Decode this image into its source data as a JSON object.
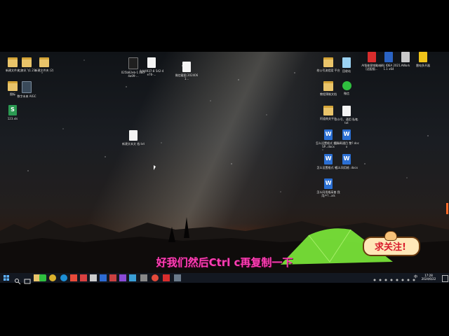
{
  "desktop": {
    "icons_left": [
      {
        "label": "新建文件夹",
        "type": "folder"
      },
      {
        "label": "红旗讯飞1.21",
        "type": "folder"
      },
      {
        "label": "新建文件夹 (2)",
        "type": "folder"
      },
      {
        "label": "图标",
        "type": "folder"
      },
      {
        "label": "数字未来 AIGC",
        "type": "shortcut"
      },
      {
        "label": "123.xls",
        "type": "xls"
      },
      {
        "label": "025b82eb-1 a8d-4a09-...",
        "type": "dark"
      },
      {
        "label": "4dd4937-8 542-4e76-...",
        "type": "doc"
      },
      {
        "label": "微信截图 2024061...",
        "type": "doc"
      },
      {
        "label": "新建文本文 档.txt",
        "type": "doc"
      }
    ],
    "icons_right": [
      {
        "label": "校公号流程案 平台",
        "type": "folder"
      },
      {
        "label": "回收站",
        "type": "recycle"
      },
      {
        "label": "教程预制文档",
        "type": "folder"
      },
      {
        "label": "微信",
        "type": "wechat"
      },
      {
        "label": "阿道南关平台",
        "type": "folder"
      },
      {
        "label": "公众号、通用 私笔.txt",
        "type": "doc"
      },
      {
        "label": "怎么设置格式 按照ASP...docx",
        "type": "word"
      },
      {
        "label": "怎么同通目 整?.docx",
        "type": "word"
      },
      {
        "label": "怎么设置格式 单...",
        "type": "word"
      },
      {
        "label": "怎么同用格 .docx",
        "type": "word"
      },
      {
        "label": "怎么同用格高普 我用户?...xls",
        "type": "word"
      }
    ],
    "icons_top_right": [
      {
        "label": "AI智能营销助 业 [适配版...",
        "type": "red"
      },
      {
        "label": "IntelliJ IDEA 2021.1.1 x64",
        "type": "blue"
      },
      {
        "label": "AWork",
        "type": "gray"
      },
      {
        "label": "雷电多开器",
        "type": "yellow"
      }
    ]
  },
  "caption": "好我们然后Ctrl c再复制一下",
  "sticker": "求关注!",
  "taskbar": {
    "start_icon": "windows-start-icon",
    "apps": [
      "search-icon",
      "task-view-icon",
      "explorer-icon",
      "chrome-icon",
      "edge-icon",
      "app-icon",
      "wps-icon",
      "app-icon",
      "app-icon",
      "app-icon",
      "app-icon",
      "app-icon",
      "app-icon",
      "app-icon",
      "app-icon",
      "chrome-icon",
      "wps-icon",
      "app-icon"
    ],
    "clock_time": "17:28",
    "clock_date": "2024/6/22",
    "ime": "中"
  },
  "colors": {
    "caption": "#ff3fb4",
    "taskbar": "#131821",
    "tent": "#7be83a"
  }
}
